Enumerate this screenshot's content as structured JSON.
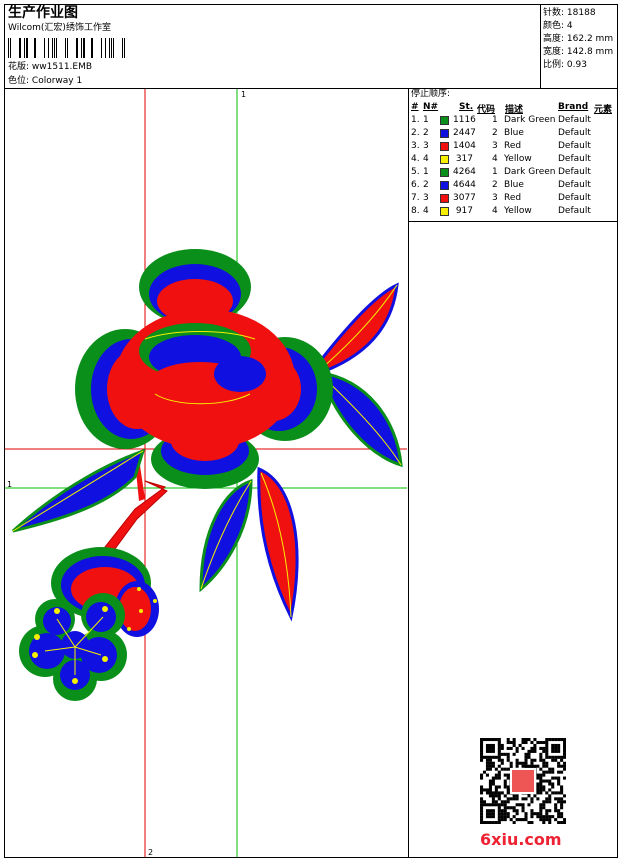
{
  "header": {
    "title": "生产作业图",
    "company": "Wilcom(汇宏)绣饰工作室",
    "design_label": "花版:",
    "design_value": "ww1511.EMB",
    "colorway_label": "色位:",
    "colorway_value": "Colorway 1"
  },
  "stats": [
    {
      "label": "针数:",
      "value": "18188"
    },
    {
      "label": "颜色:",
      "value": "4"
    },
    {
      "label": "高度:",
      "value": "162.2 mm"
    },
    {
      "label": "宽度:",
      "value": "142.8 mm"
    },
    {
      "label": "比例:",
      "value": "0.93"
    }
  ],
  "stop_panel": {
    "title": "停止顺序:",
    "headers": {
      "num": "#",
      "no": "N#",
      "st": "St.",
      "code": "代码",
      "desc": "描述",
      "brand": "Brand",
      "elem": "元素"
    },
    "rows": [
      {
        "num": "1.",
        "no": "1",
        "color": "#0a8f1a",
        "st": "1116",
        "code": "1",
        "desc": "Dark Green",
        "brand": "Default"
      },
      {
        "num": "2.",
        "no": "2",
        "color": "#1010e0",
        "st": "2447",
        "code": "2",
        "desc": "Blue",
        "brand": "Default"
      },
      {
        "num": "3.",
        "no": "3",
        "color": "#f01010",
        "st": "1404",
        "code": "3",
        "desc": "Red",
        "brand": "Default"
      },
      {
        "num": "4.",
        "no": "4",
        "color": "#f6f000",
        "st": "317",
        "code": "4",
        "desc": "Yellow",
        "brand": "Default"
      },
      {
        "num": "5.",
        "no": "1",
        "color": "#0a8f1a",
        "st": "4264",
        "code": "1",
        "desc": "Dark Green",
        "brand": "Default"
      },
      {
        "num": "6.",
        "no": "2",
        "color": "#1010e0",
        "st": "4644",
        "code": "2",
        "desc": "Blue",
        "brand": "Default"
      },
      {
        "num": "7.",
        "no": "3",
        "color": "#f01010",
        "st": "3077",
        "code": "3",
        "desc": "Red",
        "brand": "Default"
      },
      {
        "num": "8.",
        "no": "4",
        "color": "#f6f000",
        "st": "917",
        "code": "4",
        "desc": "Yellow",
        "brand": "Default"
      }
    ]
  },
  "guides": {
    "vertical_top_label": "1",
    "left_label": "1",
    "bottom_label": "2"
  },
  "colors": {
    "green": "#0a8f1a",
    "blue": "#1010e0",
    "red": "#f01010",
    "yellow": "#f6f000",
    "guide_red": "#e00000",
    "guide_green": "#00c000"
  },
  "watermark": "6xiu.com",
  "icons": {
    "qr": "qr-code-icon",
    "seal": "seal-stamp-icon"
  }
}
